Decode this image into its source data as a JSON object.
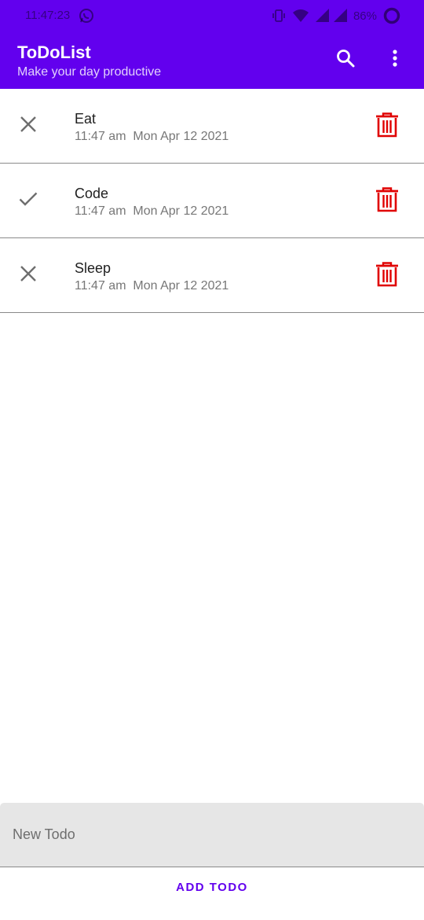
{
  "status_bar": {
    "time": "11:47:23",
    "battery": "86%",
    "left_icon": "whatsapp-icon",
    "right_icons": [
      "vibrate-icon",
      "wifi-icon",
      "signal-icon",
      "battery-icon"
    ]
  },
  "app_bar": {
    "title": "ToDoList",
    "subtitle": "Make your day productive",
    "actions": [
      "search-icon",
      "more-vert-icon"
    ]
  },
  "todos": [
    {
      "title": "Eat",
      "time": "11:47 am  Mon Apr 12 2021",
      "status_icon": "close-icon"
    },
    {
      "title": "Code",
      "time": "11:47 am  Mon Apr 12 2021",
      "status_icon": "check-icon"
    },
    {
      "title": "Sleep",
      "time": "11:47 am  Mon Apr 12 2021",
      "status_icon": "close-icon"
    }
  ],
  "new_todo": {
    "placeholder": "New Todo",
    "value": ""
  },
  "add_button": {
    "label": "ADD TODO"
  },
  "colors": {
    "primary": "#6200ee",
    "delete": "#e00000",
    "divider": "#8a8a8a",
    "input_background": "#e6e6e6"
  }
}
